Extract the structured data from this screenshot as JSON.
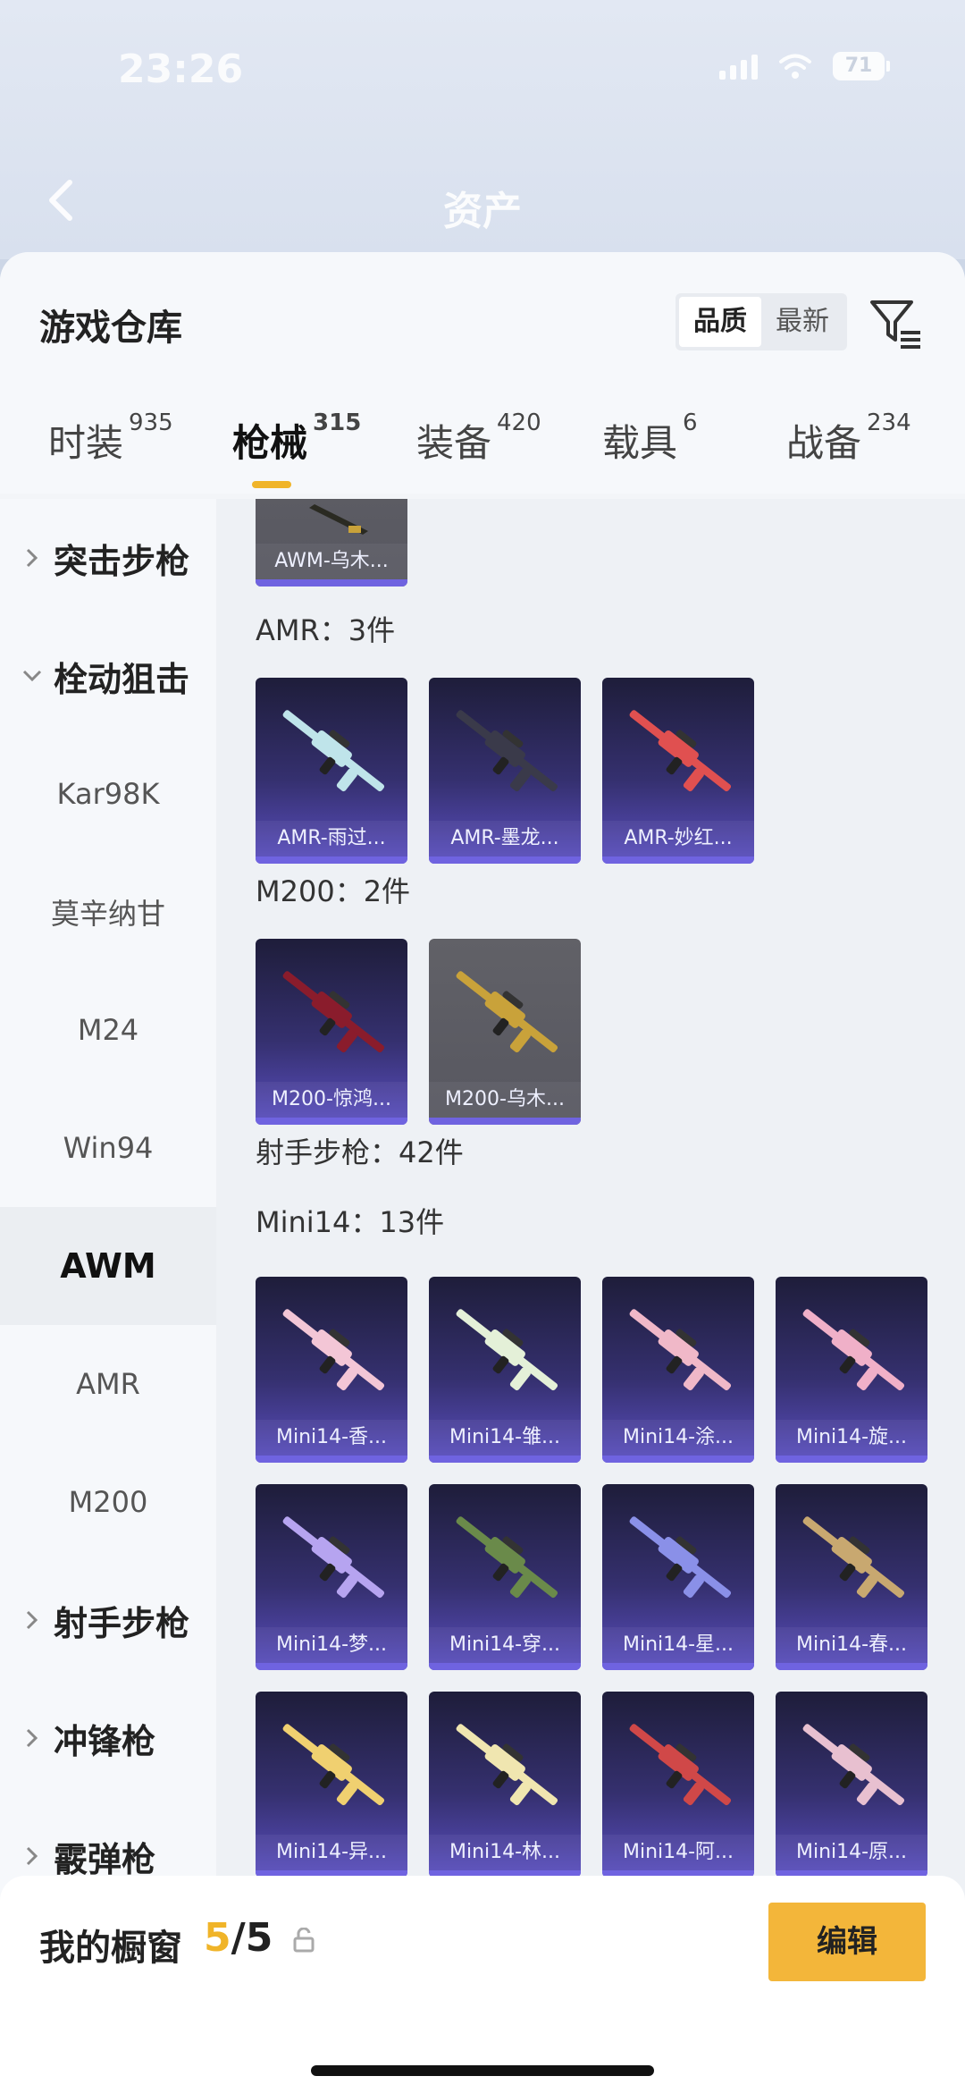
{
  "status": {
    "time": "23:26",
    "battery": "71"
  },
  "nav": {
    "title": "资产"
  },
  "sheet": {
    "title": "游戏仓库",
    "sort": {
      "options": [
        "品质",
        "最新"
      ],
      "selected": "品质"
    },
    "tabs": [
      {
        "label": "时装",
        "count": "935"
      },
      {
        "label": "枪械",
        "count": "315"
      },
      {
        "label": "装备",
        "count": "420"
      },
      {
        "label": "载具",
        "count": "6"
      },
      {
        "label": "战备",
        "count": "234"
      }
    ],
    "active_tab": "枪械"
  },
  "sidebar": {
    "items": [
      {
        "label": "突击步枪",
        "type": "group",
        "expanded": false
      },
      {
        "label": "栓动狙击",
        "type": "group",
        "expanded": true
      },
      {
        "label": "Kar98K",
        "type": "sub"
      },
      {
        "label": "莫辛纳甘",
        "type": "sub"
      },
      {
        "label": "M24",
        "type": "sub"
      },
      {
        "label": "Win94",
        "type": "sub"
      },
      {
        "label": "AWM",
        "type": "sub",
        "selected": true
      },
      {
        "label": "AMR",
        "type": "sub"
      },
      {
        "label": "M200",
        "type": "sub"
      },
      {
        "label": "射手步枪",
        "type": "group",
        "expanded": false
      },
      {
        "label": "冲锋枪",
        "type": "group",
        "expanded": false
      },
      {
        "label": "霰弹枪",
        "type": "group",
        "expanded": false
      }
    ]
  },
  "content": {
    "top_card": {
      "name": "AWM-乌木..."
    },
    "sections": [
      {
        "label": "AMR：3件",
        "items": [
          "AMR-雨过...",
          "AMR-墨龙...",
          "AMR-妙红..."
        ]
      },
      {
        "label": "M200：2件",
        "items": [
          "M200-惊鸿...",
          "M200-乌木..."
        ]
      },
      {
        "label": "射手步枪：42件",
        "items": []
      },
      {
        "label": "Mini14：13件",
        "items": [
          "Mini14-香...",
          "Mini14-雏...",
          "Mini14-涂...",
          "Mini14-旋...",
          "Mini14-梦...",
          "Mini14-穿...",
          "Mini14-星...",
          "Mini14-春...",
          "Mini14-异...",
          "Mini14-林...",
          "Mini14-阿...",
          "Mini14-原..."
        ]
      }
    ],
    "gun_colors": {
      "AMR-雨过...": "#bfe4ea",
      "AMR-墨龙...": "#3a3a4a",
      "AMR-妙红...": "#e05050",
      "M200-惊鸿...": "#8a1c2c",
      "M200-乌木...": "#c9a23a",
      "Mini14-香...": "#f3c6d6",
      "Mini14-雏...": "#e4f0d8",
      "Mini14-涂...": "#f0b8c8",
      "Mini14-旋...": "#f0b0c8",
      "Mini14-梦...": "#b6a4f0",
      "Mini14-穿...": "#6a8a4a",
      "Mini14-星...": "#8a90e8",
      "Mini14-春...": "#c8a870",
      "Mini14-异...": "#f0d070",
      "Mini14-林...": "#f0e6b0",
      "Mini14-阿...": "#d04848",
      "Mini14-原...": "#e8c0d0"
    }
  },
  "showcase": {
    "label": "我的橱窗",
    "current": "5",
    "total": "/5",
    "edit_label": "编辑"
  },
  "colors": {
    "accent": "#f3b63a",
    "card_gradient_top": "#1e1d3a",
    "card_gradient_bottom": "#5a4ec0"
  }
}
